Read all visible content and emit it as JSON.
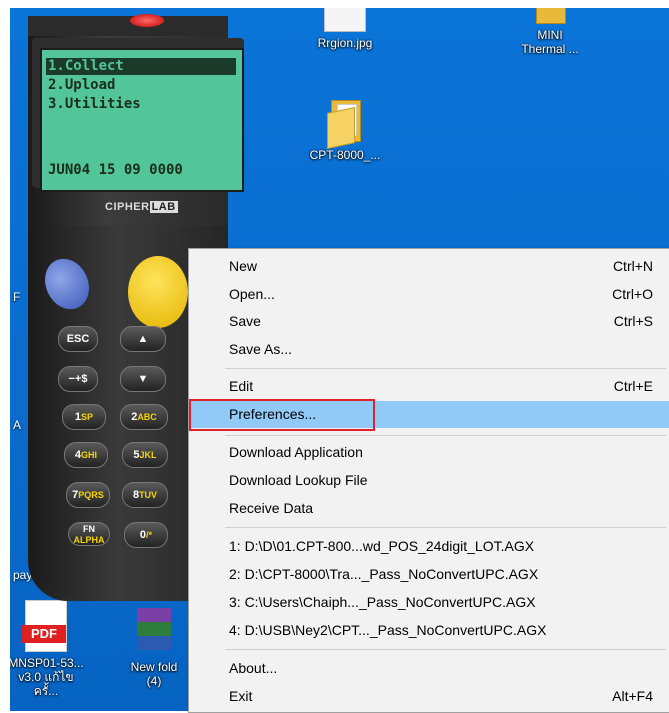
{
  "desktop": {
    "icons": [
      {
        "label": "Rrgion.jpg"
      },
      {
        "label": "MINI Thermal ..."
      },
      {
        "label": "CPT-8000_..."
      },
      {
        "label": "MNSP01-53... v3.0 แก้ไขครั้..."
      },
      {
        "label": "New fold (4)"
      }
    ],
    "partial_labels": [
      "F",
      "A",
      "payr"
    ]
  },
  "device": {
    "lcd_lines": [
      "1.Collect",
      "2.Upload",
      "3.Utilities",
      "JUN04 15 09 0000"
    ],
    "brand": "CIPHER",
    "brand_box": "LAB",
    "keys": {
      "esc": "ESC",
      "minus": "−+$",
      "k1": "1",
      "k1_sub": "SP",
      "k2": "2",
      "k2_sub": "ABC",
      "k4": "4",
      "k4_sub": "GHI",
      "k5": "5",
      "k5_sub": "JKL",
      "k7": "7",
      "k7_sub": "PQRS",
      "k8": "8",
      "k8_sub": "TUV",
      "fn": "FN",
      "fn_sub": "ALPHA",
      "k0": "0",
      "k0_sub": "/*"
    }
  },
  "menu": {
    "items": [
      {
        "label": "New",
        "shortcut": "Ctrl+N"
      },
      {
        "label": "Open...",
        "shortcut": "Ctrl+O"
      },
      {
        "label": "Save",
        "shortcut": "Ctrl+S"
      },
      {
        "label": "Save As...",
        "shortcut": ""
      },
      {
        "label": "Edit",
        "shortcut": "Ctrl+E"
      },
      {
        "label": "Preferences...",
        "shortcut": ""
      },
      {
        "label": "Download Application",
        "shortcut": ""
      },
      {
        "label": "Download Lookup File",
        "shortcut": ""
      },
      {
        "label": "Receive Data",
        "shortcut": ""
      },
      {
        "label": "1: D:\\D\\01.CPT-800...wd_POS_24digit_LOT.AGX",
        "shortcut": ""
      },
      {
        "label": "2: D:\\CPT-8000\\Tra..._Pass_NoConvertUPC.AGX",
        "shortcut": ""
      },
      {
        "label": "3: C:\\Users\\Chaiph..._Pass_NoConvertUPC.AGX",
        "shortcut": ""
      },
      {
        "label": "4: D:\\USB\\Ney2\\CPT..._Pass_NoConvertUPC.AGX",
        "shortcut": ""
      },
      {
        "label": "About...",
        "shortcut": ""
      },
      {
        "label": "Exit",
        "shortcut": "Alt+F4"
      }
    ],
    "highlighted_index": 5,
    "highlight_color": "#91c9f7",
    "callout_color": "#e0202a"
  }
}
